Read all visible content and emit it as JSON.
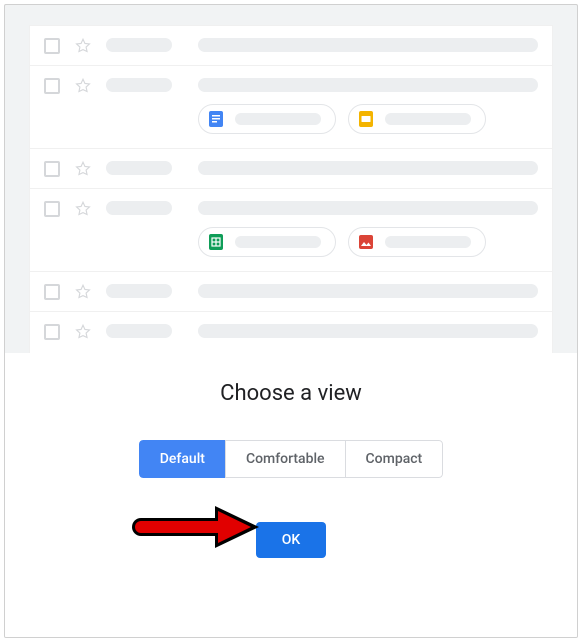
{
  "dialog": {
    "title": "Choose a view",
    "options": {
      "default": "Default",
      "comfortable": "Comfortable",
      "compact": "Compact"
    },
    "ok_label": "OK"
  },
  "icons": {
    "docs": "docs-icon",
    "slides": "slides-icon",
    "sheets": "sheets-icon",
    "photos": "photos-icon"
  },
  "colors": {
    "primary": "#1a73e8",
    "segment_active": "#4285f4",
    "docs": "#4285f4",
    "slides": "#f4b400",
    "sheets": "#0f9d58",
    "photos": "#db4437"
  }
}
